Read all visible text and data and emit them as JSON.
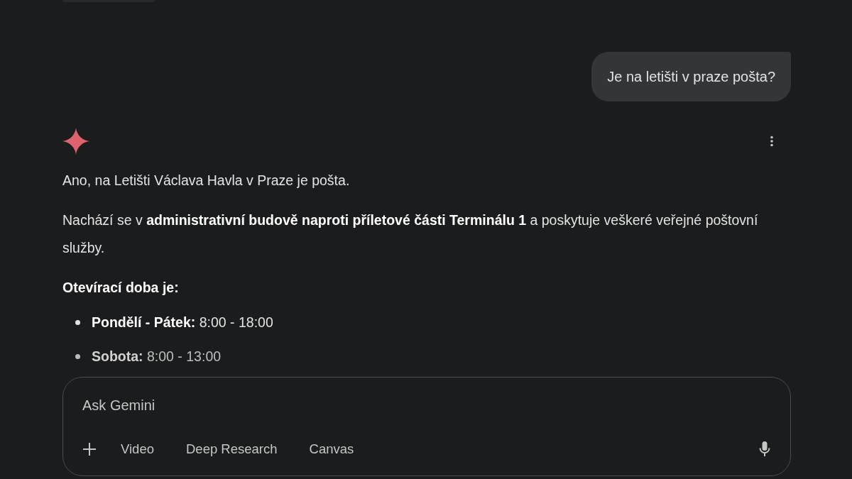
{
  "user_message": {
    "text": "Je na letišti v praze pošta?"
  },
  "response": {
    "paragraphs": [
      "Ano, na Letišti Václava Havla v Praze je pošta.",
      "Nachází se v **administrativní budově naproti příletové části Terminálu 1** a poskytuje veškeré veřejné poštovní služby."
    ],
    "heading": "Otevírací doba je:",
    "hours": [
      "**Pondělí - Pátek:** 8:00 - 18:00",
      "**Sobota:** 8:00 - 13:00"
    ]
  },
  "prompt": {
    "placeholder": "Ask Gemini",
    "tools": [
      "Video",
      "Deep Research",
      "Canvas"
    ]
  }
}
